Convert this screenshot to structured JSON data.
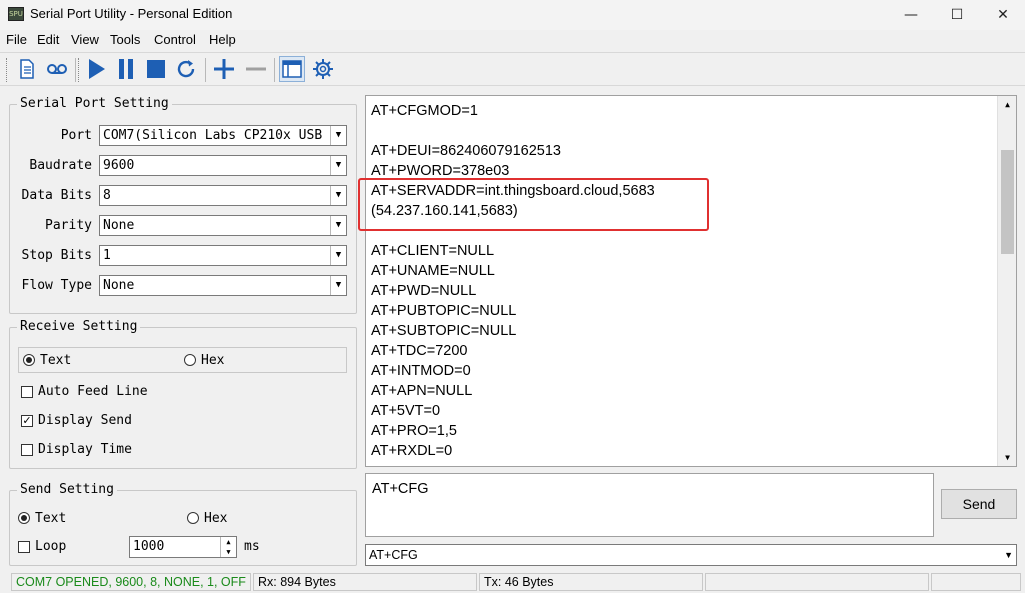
{
  "window": {
    "title": "Serial Port Utility - Personal Edition",
    "app_icon_text": "SPU"
  },
  "menu": [
    "File",
    "Edit",
    "View",
    "Tools",
    "Control",
    "Help"
  ],
  "serial_port_setting": {
    "title": "Serial Port Setting",
    "port_label": "Port",
    "port_value": "COM7(Silicon Labs CP210x USB",
    "baudrate_label": "Baudrate",
    "baudrate_value": "9600",
    "databits_label": "Data Bits",
    "databits_value": "8",
    "parity_label": "Parity",
    "parity_value": "None",
    "stopbits_label": "Stop Bits",
    "stopbits_value": "1",
    "flowtype_label": "Flow Type",
    "flowtype_value": "None"
  },
  "receive_setting": {
    "title": "Receive Setting",
    "text_label": "Text",
    "hex_label": "Hex",
    "auto_feed_line": "Auto Feed Line",
    "display_send": "Display Send",
    "display_time": "Display Time",
    "mode": "Text",
    "display_send_checked": true
  },
  "send_setting": {
    "title": "Send Setting",
    "text_label": "Text",
    "hex_label": "Hex",
    "loop_label": "Loop",
    "interval_value": "1000",
    "interval_unit": "ms",
    "mode": "Text"
  },
  "output_lines": [
    "AT+CFGMOD=1",
    "",
    "AT+DEUI=862406079162513",
    "AT+PWORD=378e03",
    "AT+SERVADDR=int.thingsboard.cloud,5683",
    "(54.237.160.141,5683)",
    "",
    "AT+CLIENT=NULL",
    "AT+UNAME=NULL",
    "AT+PWD=NULL",
    "AT+PUBTOPIC=NULL",
    "AT+SUBTOPIC=NULL",
    "AT+TDC=7200",
    "AT+INTMOD=0",
    "AT+APN=NULL",
    "AT+5VT=0",
    "AT+PRO=1,5",
    "AT+RXDL=0"
  ],
  "input": {
    "value": "AT+CFG",
    "send_label": "Send",
    "history_value": "AT+CFG"
  },
  "status": {
    "connection": "COM7 OPENED, 9600, 8, NONE, 1, OFF",
    "rx": "Rx: 894 Bytes",
    "tx": "Tx: 46 Bytes"
  },
  "colors": {
    "status_ok": "#1a8a1a",
    "toolbar_blue": "#1e5fb4",
    "highlight": "#e03030"
  },
  "icons": {
    "toolbar": [
      "document-icon",
      "tape-icon",
      "play-icon",
      "pause-icon",
      "stop-icon",
      "refresh-icon",
      "plus-icon",
      "minus-icon",
      "window-icon",
      "gear-icon"
    ]
  }
}
